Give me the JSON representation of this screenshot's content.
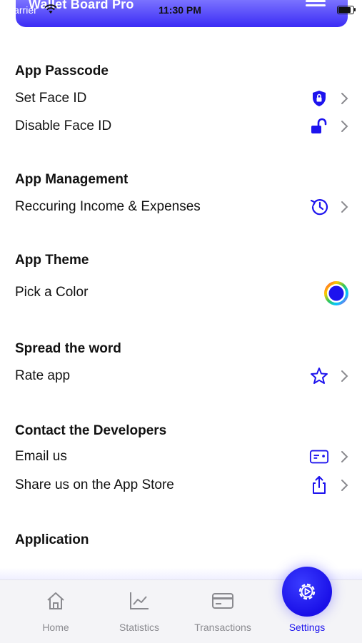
{
  "status_bar": {
    "carrier": "Carrier",
    "time": "11:30 PM"
  },
  "header": {
    "title": "Wallet Board Pro"
  },
  "sections": {
    "passcode": {
      "title": "App Passcode",
      "items": [
        {
          "label": "Set Face ID",
          "icon": "shield-lock-icon"
        },
        {
          "label": "Disable Face ID",
          "icon": "unlock-icon"
        }
      ]
    },
    "management": {
      "title": "App Management",
      "items": [
        {
          "label": "Reccuring Income & Expenses",
          "icon": "history-icon"
        }
      ]
    },
    "theme": {
      "title": "App Theme",
      "items": [
        {
          "label": "Pick a Color",
          "icon": "color-wheel-icon"
        }
      ]
    },
    "spread": {
      "title": "Spread the word",
      "items": [
        {
          "label": "Rate app",
          "icon": "star-icon"
        }
      ]
    },
    "contact": {
      "title": "Contact the Developers",
      "items": [
        {
          "label": "Email us",
          "icon": "card-icon"
        },
        {
          "label": "Share us on the App Store",
          "icon": "share-icon"
        }
      ]
    },
    "application": {
      "title": "Application"
    }
  },
  "tabbar": {
    "tabs": [
      {
        "label": "Home",
        "icon": "home-icon"
      },
      {
        "label": "Statistics",
        "icon": "chart-icon"
      },
      {
        "label": "Transactions",
        "icon": "card-icon"
      },
      {
        "label": "Settings",
        "icon": "gear-icon"
      }
    ],
    "active": "Settings"
  },
  "colors": {
    "accent": "#1d13ee",
    "header_gradient_top": "#7a72ff",
    "inactive_tab": "#8a8a8f"
  }
}
